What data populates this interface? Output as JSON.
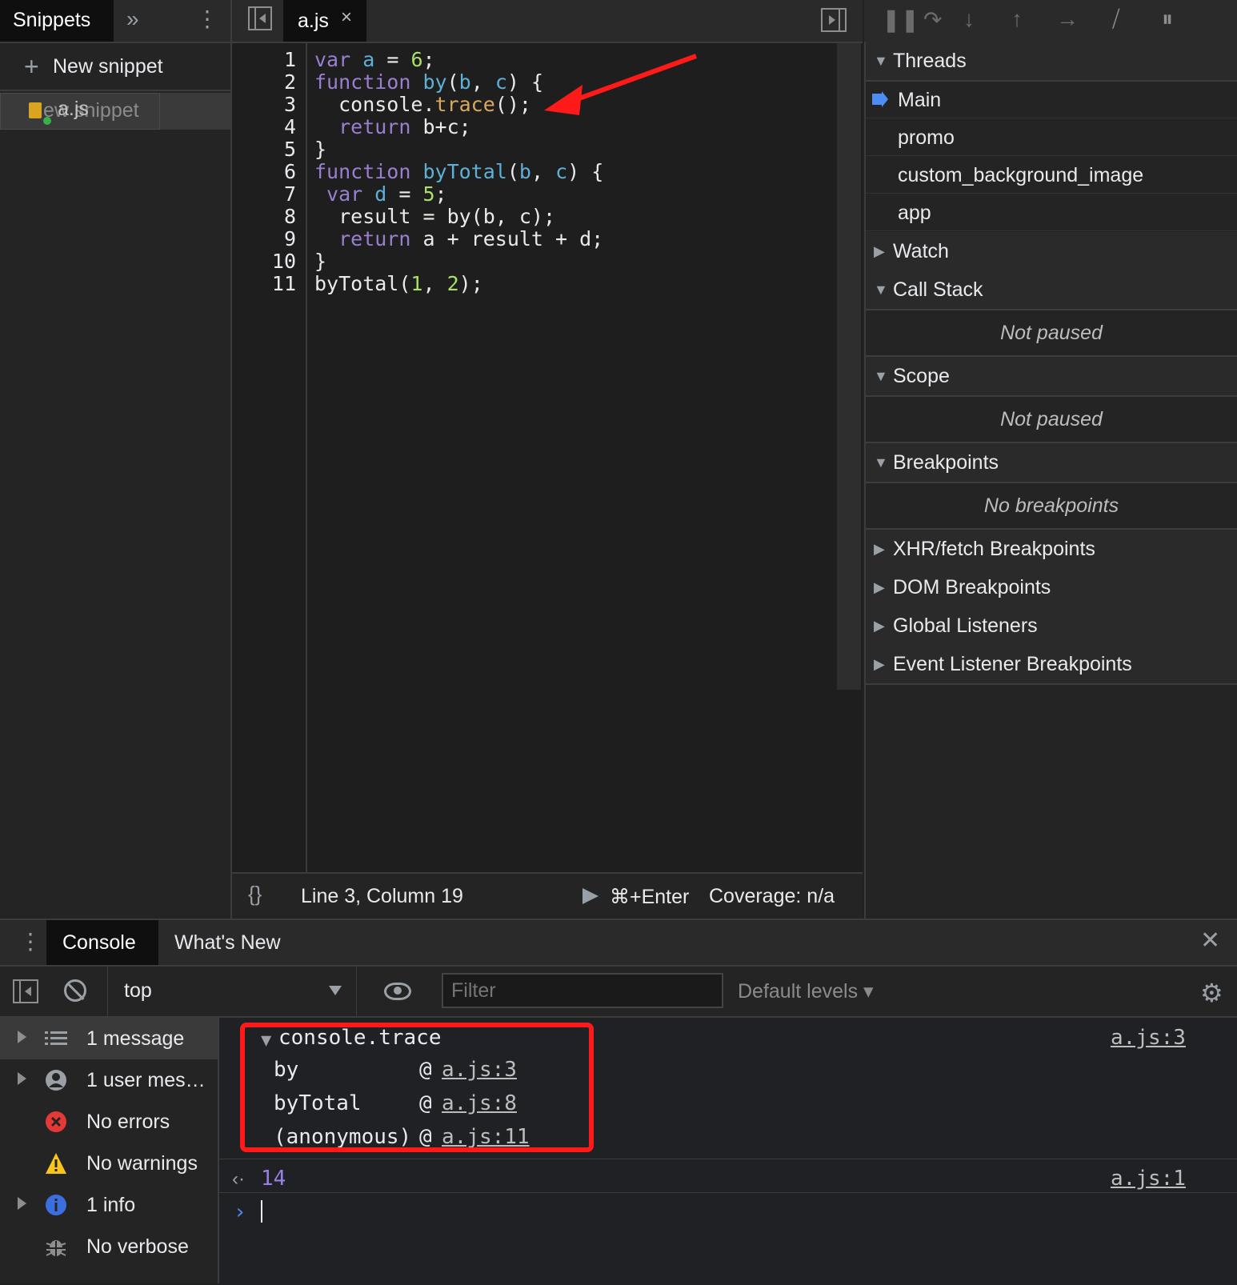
{
  "navigator": {
    "tab_label": "Snippets",
    "more_tabs_icon": "»",
    "menu_icon": "⋮",
    "new_snippet_label": "New snippet",
    "files": [
      {
        "name": "a.js",
        "drag_ghost": "New snippet"
      }
    ]
  },
  "editor": {
    "tab_name": "a.js",
    "close_glyph": "×",
    "lines": [
      "1",
      "2",
      "3",
      "4",
      "5",
      "6",
      "7",
      "8",
      "9",
      "10",
      "11"
    ],
    "status": {
      "format_icon": "{}",
      "cursor": "Line 3, Column 19",
      "run_shortcut": "⌘+Enter",
      "coverage": "Coverage: n/a"
    }
  },
  "debugger": {
    "threads_title": "Threads",
    "threads": [
      "Main",
      "promo",
      "custom_background_image",
      "app"
    ],
    "watch_title": "Watch",
    "callstack_title": "Call Stack",
    "callstack_empty": "Not paused",
    "scope_title": "Scope",
    "scope_empty": "Not paused",
    "breakpoints_title": "Breakpoints",
    "breakpoints_empty": "No breakpoints",
    "xhr_title": "XHR/fetch Breakpoints",
    "dom_title": "DOM Breakpoints",
    "global_title": "Global Listeners",
    "event_title": "Event Listener Breakpoints"
  },
  "drawer": {
    "tabs": [
      "Console",
      "What's New"
    ],
    "close_glyph": "✕",
    "context": "top",
    "filter_placeholder": "Filter",
    "levels": "Default levels ▾",
    "sidebar": [
      {
        "label": "1 message",
        "icon": "list-icon"
      },
      {
        "label": "1 user mes…",
        "icon": "user-icon"
      },
      {
        "label": "No errors",
        "icon": "error-icon"
      },
      {
        "label": "No warnings",
        "icon": "warning-icon"
      },
      {
        "label": "1 info",
        "icon": "info-icon"
      },
      {
        "label": "No verbose",
        "icon": "bug-icon"
      }
    ],
    "trace": {
      "header": "console.trace",
      "source": "a.js:3",
      "frames": [
        {
          "fn": "by",
          "loc": "a.js:3"
        },
        {
          "fn": "byTotal",
          "loc": "a.js:8"
        },
        {
          "fn": "(anonymous)",
          "loc": "a.js:11"
        }
      ]
    },
    "result": {
      "value": "14",
      "source": "a.js:1"
    },
    "colors": {
      "accent": "#4d8bf5",
      "annotation": "#ff1a1a"
    }
  }
}
